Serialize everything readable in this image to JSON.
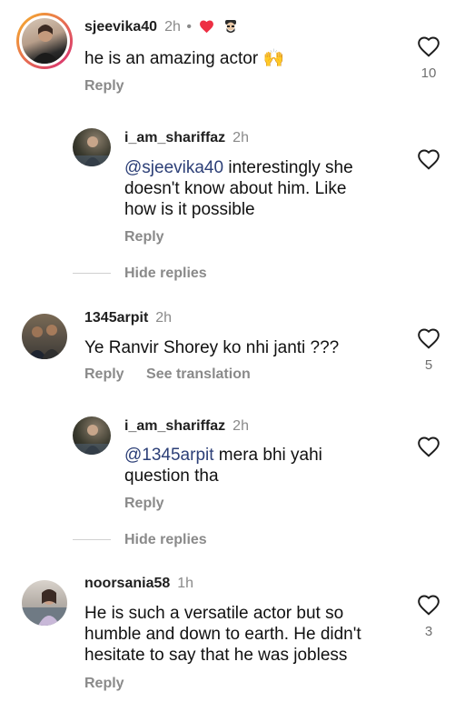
{
  "comments": [
    {
      "username": "sjeevika40",
      "time": "2h",
      "text_parts": [
        "he is an amazing actor ",
        "🙌"
      ],
      "reply_label": "Reply",
      "likes": "10",
      "replies": [
        {
          "username": "i_am_shariffaz",
          "time": "2h",
          "mention": "@sjeevika40",
          "text_line1": " interestingly she",
          "text_line2": "doesn't know about him. Like",
          "text_line3": "how is it possible",
          "reply_label": "Reply"
        }
      ],
      "hide_replies_label": "Hide replies"
    },
    {
      "username": "1345arpit",
      "time": "2h",
      "text": "Ye Ranvir Shorey ko nhi janti ???",
      "reply_label": "Reply",
      "see_translation_label": "See translation",
      "likes": "5",
      "replies": [
        {
          "username": "i_am_shariffaz",
          "time": "2h",
          "mention": "@1345arpit",
          "text_line1": " mera bhi yahi",
          "text_line2": "question tha",
          "reply_label": "Reply"
        }
      ],
      "hide_replies_label": "Hide replies"
    },
    {
      "username": "noorsania58",
      "time": "1h",
      "text_line1": "He is such a versatile actor but so",
      "text_line2": "humble and down to earth. He didn't",
      "text_line3": "hesitate to say that he was jobless",
      "reply_label": "Reply",
      "likes": "3"
    }
  ],
  "icons": {
    "like": "heart-outline-icon",
    "creator_liked": "red-heart-icon",
    "separator": "dot-separator"
  },
  "colors": {
    "mention": "#2c3f77",
    "secondary_text": "#8a8a8a",
    "heart_red": "#ed2f43",
    "story_ring_start": "#f7b32b",
    "story_ring_end": "#d62976"
  }
}
